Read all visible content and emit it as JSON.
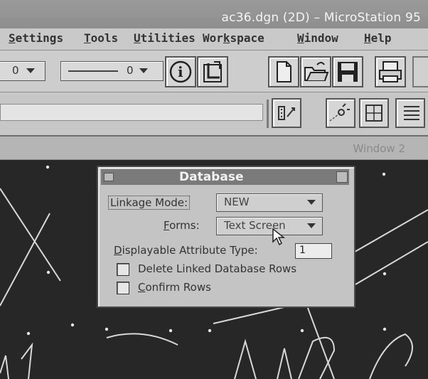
{
  "window": {
    "title": "ac36.dgn (2D) – MicroStation 95"
  },
  "menu": [
    {
      "label": "Settings",
      "key": "S"
    },
    {
      "label": "Tools",
      "key": "T"
    },
    {
      "label": "Utilities",
      "key": "U"
    },
    {
      "label": "Workspace",
      "key": "k"
    },
    {
      "label": "Window",
      "key": "W"
    },
    {
      "label": "Help",
      "key": "H"
    }
  ],
  "toolbar": {
    "level_value": "0",
    "weight_value": "0",
    "buttons": [
      "info-icon",
      "edit-icon",
      "new-file-icon",
      "open-folder-icon",
      "save-icon",
      "print-icon"
    ]
  },
  "toolbar2": {
    "buttons": [
      "tool-icon-1",
      "tool-icon-2",
      "tool-icon-3",
      "tool-icon-4"
    ]
  },
  "view": {
    "title": "Window 2"
  },
  "dialog": {
    "title": "Database",
    "linkage_mode_label": "Linkage Mode:",
    "linkage_mode_value": "NEW",
    "forms_label": "Forms:",
    "forms_value": "Text Screen",
    "attr_type_label": "Displayable Attribute Type:",
    "attr_type_value": "1",
    "delete_rows_label": "Delete Linked Database Rows",
    "delete_rows_checked": false,
    "confirm_rows_label": "Confirm Rows",
    "confirm_rows_checked": false
  }
}
